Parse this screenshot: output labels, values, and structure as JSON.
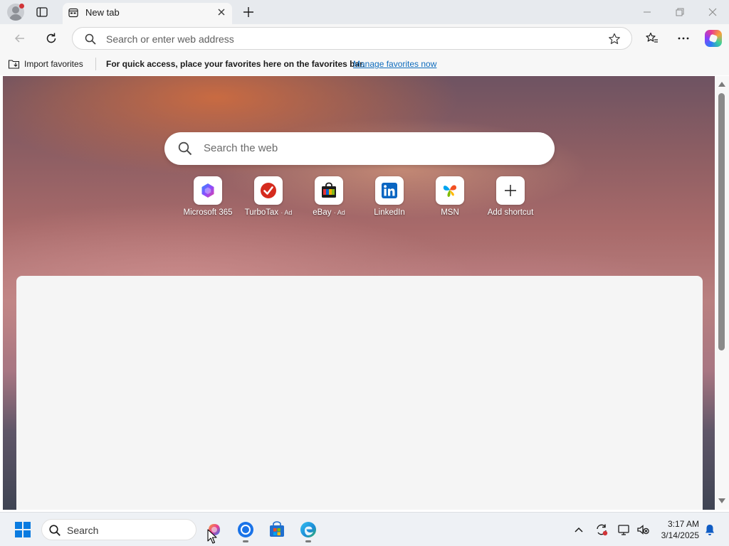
{
  "browser": {
    "tab": {
      "title": "New tab"
    },
    "address_bar": {
      "placeholder": "Search or enter web address"
    },
    "favorites_bar": {
      "import_label": "Import favorites",
      "message": "For quick access, place your favorites here on the favorites bar.",
      "manage_link": "Manage favorites now"
    }
  },
  "new_tab_page": {
    "search": {
      "placeholder": "Search the web"
    },
    "shortcuts": [
      {
        "label": "Microsoft 365",
        "ad": "",
        "icon": "microsoft365-icon"
      },
      {
        "label": "TurboTax",
        "ad": "· Ad",
        "icon": "turbotax-icon"
      },
      {
        "label": "eBay",
        "ad": "· Ad",
        "icon": "ebay-icon"
      },
      {
        "label": "LinkedIn",
        "ad": "",
        "icon": "linkedin-icon"
      },
      {
        "label": "MSN",
        "ad": "",
        "icon": "msn-icon"
      },
      {
        "label": "Add shortcut",
        "ad": "",
        "icon": "plus-icon"
      }
    ]
  },
  "taskbar": {
    "search_label": "Search",
    "time": "3:17 AM",
    "date": "3/14/2025"
  },
  "colors": {
    "accent": "#0f6cbd",
    "windows_blue": "#0a7be0",
    "notification_red": "#d13438"
  }
}
